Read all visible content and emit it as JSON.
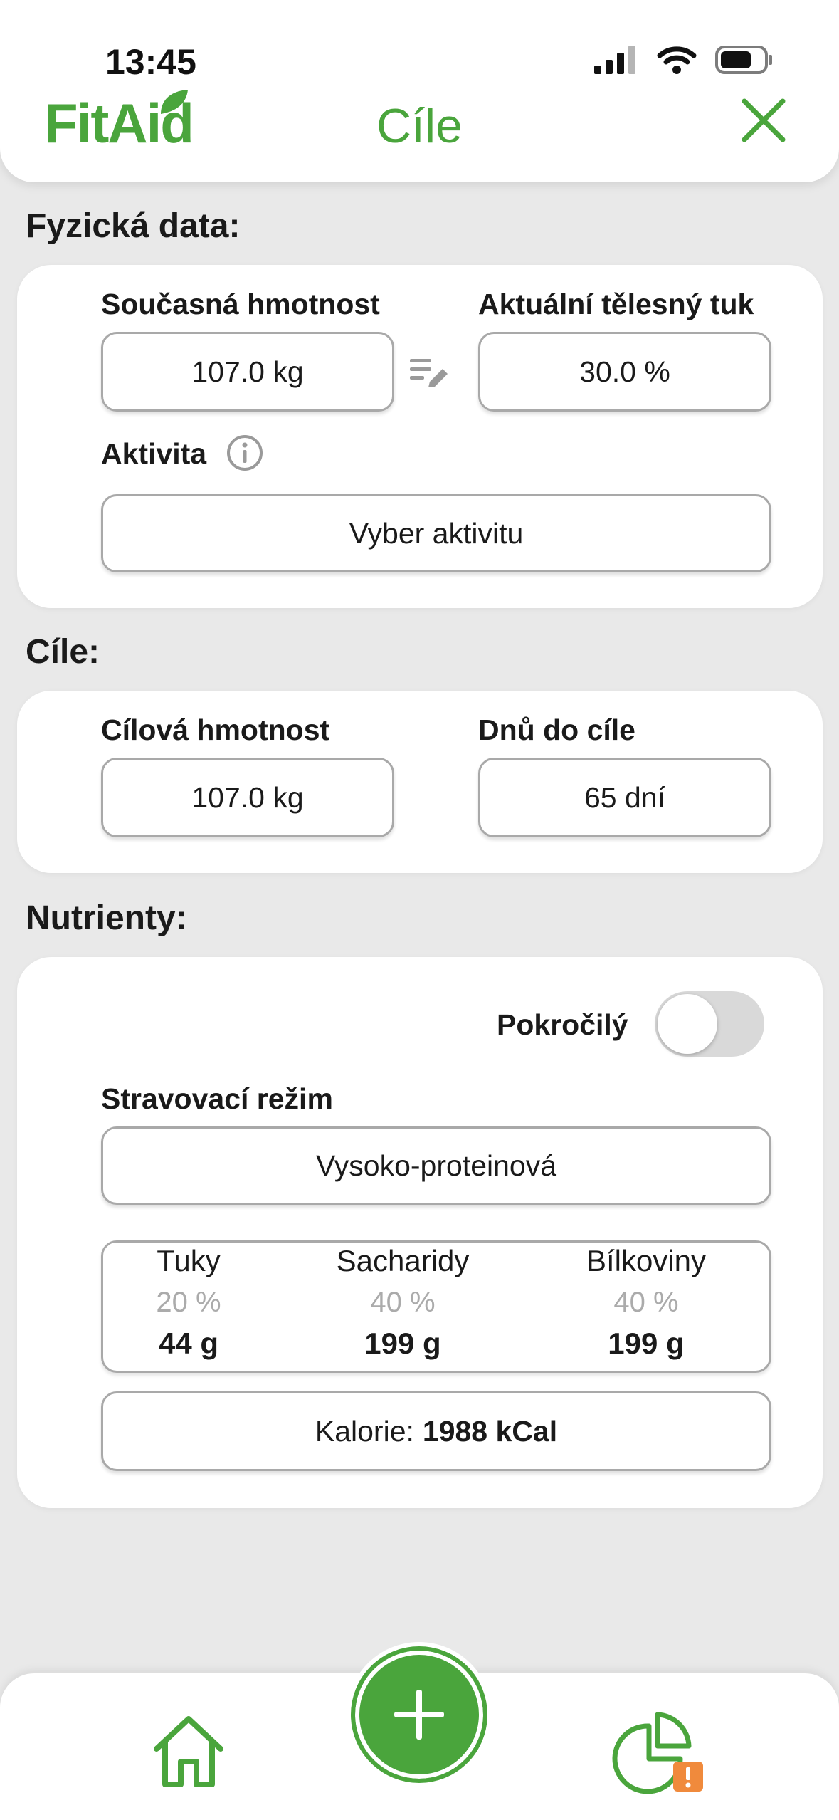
{
  "status": {
    "time": "13:45"
  },
  "header": {
    "logo": "FitAid",
    "title": "Cíle"
  },
  "physical": {
    "section_title": "Fyzická data:",
    "weight_label": "Současná hmotnost",
    "weight_value": "107.0 kg",
    "bodyfat_label": "Aktuální tělesný tuk",
    "bodyfat_value": "30.0 %",
    "activity_label": "Aktivita",
    "activity_placeholder": "Vyber aktivitu"
  },
  "goals": {
    "section_title": "Cíle:",
    "target_weight_label": "Cílová hmotnost",
    "target_weight_value": "107.0 kg",
    "days_label": "Dnů do cíle",
    "days_value": "65 dní"
  },
  "nutrients": {
    "section_title": "Nutrienty:",
    "advanced_label": "Pokročilý",
    "advanced_on": false,
    "diet_label": "Stravovací režim",
    "diet_value": "Vysoko-proteinová",
    "macros": [
      {
        "name": "Tuky",
        "percent": "20 %",
        "grams": "44 g"
      },
      {
        "name": "Sacharidy",
        "percent": "40 %",
        "grams": "199 g"
      },
      {
        "name": "Bílkoviny",
        "percent": "40 %",
        "grams": "199 g"
      }
    ],
    "calories_label": "Kalorie:",
    "calories_value": "1988 kCal"
  },
  "bottom_nav": {
    "icons": [
      "home-icon",
      "add-icon",
      "chart-alert-icon"
    ]
  },
  "colors": {
    "accent": "#4aa53c",
    "alert": "#f08a3c"
  }
}
